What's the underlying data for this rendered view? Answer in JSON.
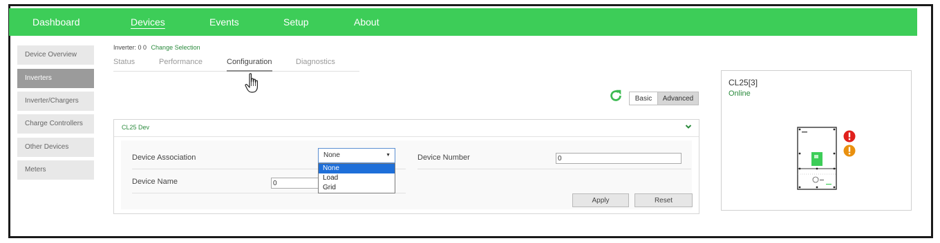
{
  "topnav": {
    "items": [
      {
        "label": "Dashboard"
      },
      {
        "label": "Devices"
      },
      {
        "label": "Events"
      },
      {
        "label": "Setup"
      },
      {
        "label": "About"
      }
    ],
    "active": "Devices"
  },
  "sidebar": {
    "items": [
      {
        "label": "Device Overview"
      },
      {
        "label": "Inverters"
      },
      {
        "label": "Inverter/Chargers"
      },
      {
        "label": "Charge Controllers"
      },
      {
        "label": "Other Devices"
      },
      {
        "label": "Meters"
      }
    ],
    "active": "Inverters"
  },
  "selection": {
    "text": "Inverter: 0 0",
    "link": "Change Selection"
  },
  "tabs": {
    "items": [
      {
        "label": "Status"
      },
      {
        "label": "Performance"
      },
      {
        "label": "Configuration"
      },
      {
        "label": "Diagnostics"
      }
    ],
    "active": "Configuration"
  },
  "mode_toggle": {
    "basic": "Basic",
    "advanced": "Advanced",
    "active": "Advanced"
  },
  "panel": {
    "title": "CL25 Dev",
    "fields": {
      "device_association_label": "Device Association",
      "device_association_value": "None",
      "device_association_options": [
        "None",
        "Load",
        "Grid"
      ],
      "device_number_label": "Device Number",
      "device_number_value": "0",
      "device_name_label": "Device Name",
      "device_name_value": "0"
    },
    "apply": "Apply",
    "reset": "Reset"
  },
  "device_card": {
    "name": "CL25[3]",
    "status": "Online"
  },
  "colors": {
    "brand_green": "#3dcd58",
    "link_green": "#2a8a3c",
    "error_red": "#e0201c",
    "warning_orange": "#e9900e"
  },
  "icons": [
    "refresh-icon",
    "chevron-down-icon",
    "hand-cursor-icon",
    "error-icon",
    "warning-icon"
  ]
}
